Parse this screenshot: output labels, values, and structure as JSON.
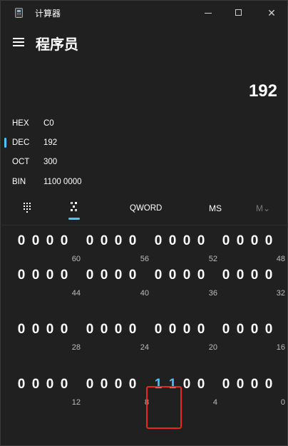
{
  "app": {
    "title": "计算器",
    "mode": "程序员"
  },
  "display": {
    "result": "192"
  },
  "radix": [
    {
      "label": "HEX",
      "value": "C0",
      "selected": false
    },
    {
      "label": "DEC",
      "value": "192",
      "selected": true
    },
    {
      "label": "OCT",
      "value": "300",
      "selected": false
    },
    {
      "label": "BIN",
      "value": "1100 0000",
      "selected": false
    }
  ],
  "toolbar": {
    "word_size": "QWORD",
    "memory_store": "MS",
    "memory_menu": "M⌄"
  },
  "icons": {
    "app": "calculator-app-icon",
    "menu": "hamburger-menu-icon",
    "keypad": "full-keypad-icon",
    "bit_toggle": "bit-toggling-keypad-icon",
    "minimize": "minimize-icon",
    "maximize": "maximize-icon",
    "close": "close-icon"
  },
  "colors": {
    "accent": "#4cc2ff",
    "highlight_box": "#e8281e",
    "background": "#202020"
  },
  "bit_groups": [
    {
      "bits": [
        "0",
        "0",
        "0",
        "0"
      ],
      "position": "60"
    },
    {
      "bits": [
        "0",
        "0",
        "0",
        "0"
      ],
      "position": "56"
    },
    {
      "bits": [
        "0",
        "0",
        "0",
        "0"
      ],
      "position": "52"
    },
    {
      "bits": [
        "0",
        "0",
        "0",
        "0"
      ],
      "position": "48"
    },
    {
      "bits": [
        "0",
        "0",
        "0",
        "0"
      ],
      "position": "44"
    },
    {
      "bits": [
        "0",
        "0",
        "0",
        "0"
      ],
      "position": "40"
    },
    {
      "bits": [
        "0",
        "0",
        "0",
        "0"
      ],
      "position": "36"
    },
    {
      "bits": [
        "0",
        "0",
        "0",
        "0"
      ],
      "position": "32"
    },
    {
      "bits": [
        "0",
        "0",
        "0",
        "0"
      ],
      "position": "28"
    },
    {
      "bits": [
        "0",
        "0",
        "0",
        "0"
      ],
      "position": "24"
    },
    {
      "bits": [
        "0",
        "0",
        "0",
        "0"
      ],
      "position": "20"
    },
    {
      "bits": [
        "0",
        "0",
        "0",
        "0"
      ],
      "position": "16"
    },
    {
      "bits": [
        "0",
        "0",
        "0",
        "0"
      ],
      "position": "12"
    },
    {
      "bits": [
        "0",
        "0",
        "0",
        "0"
      ],
      "position": "8"
    },
    {
      "bits": [
        "1",
        "1",
        "0",
        "0"
      ],
      "position": "4"
    },
    {
      "bits": [
        "0",
        "0",
        "0",
        "0"
      ],
      "position": "0"
    }
  ]
}
